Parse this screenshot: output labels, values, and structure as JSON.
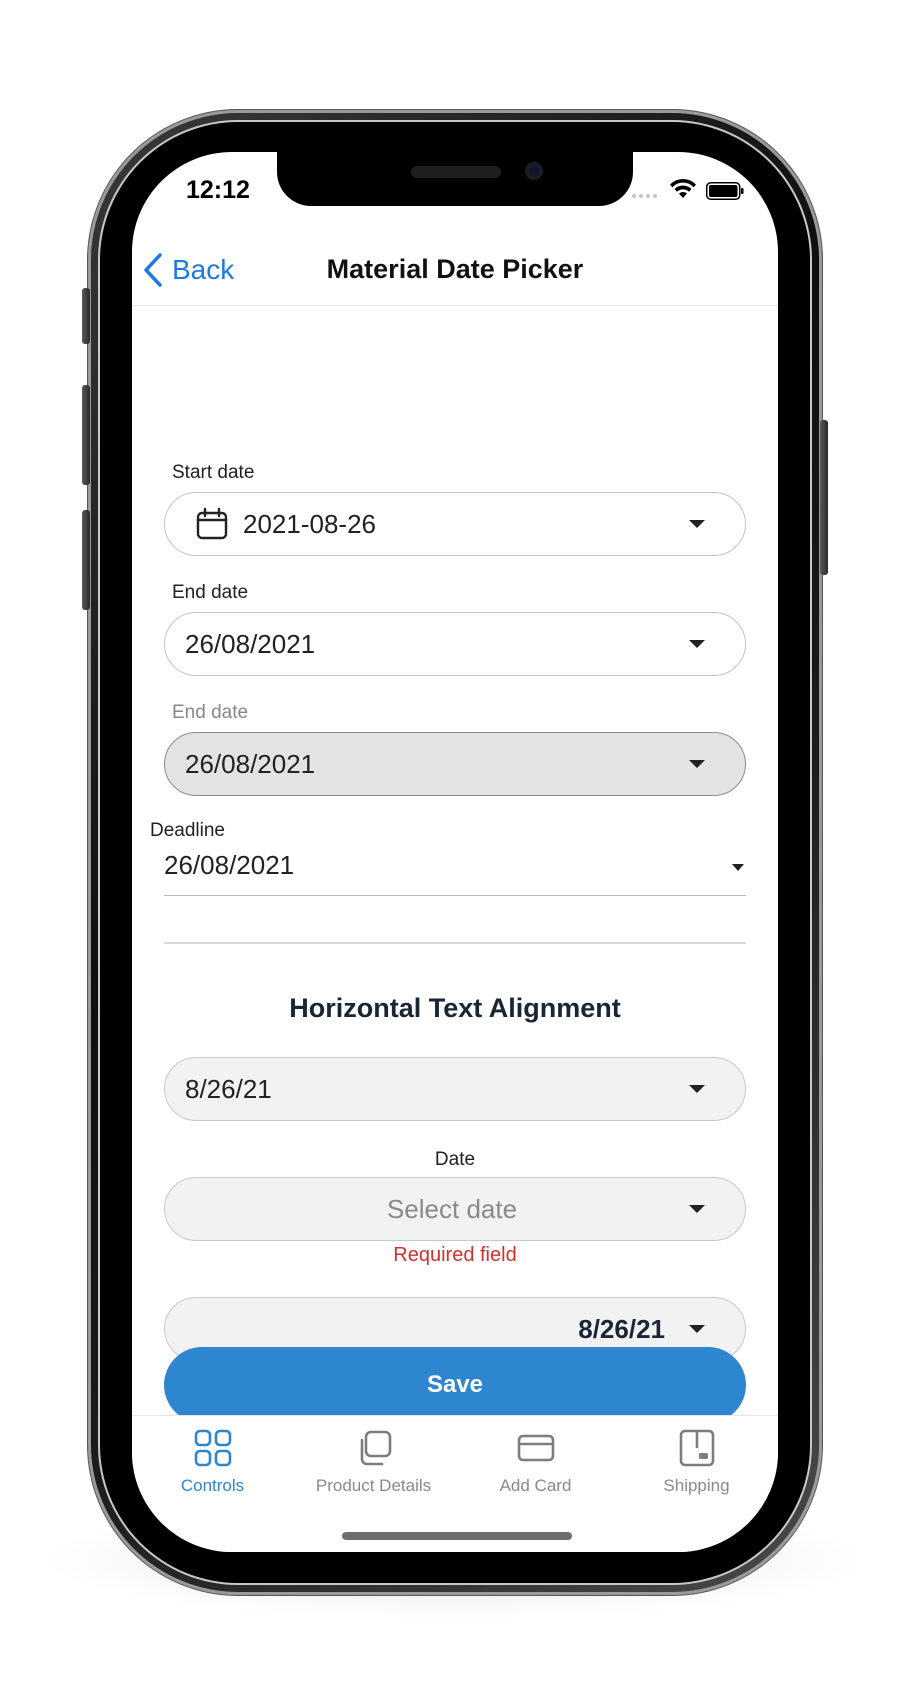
{
  "status_bar": {
    "time": "12:12"
  },
  "navbar": {
    "back_label": "Back",
    "title": "Material Date Picker"
  },
  "fields": {
    "start_date": {
      "label": "Start date",
      "value": "2021-08-26",
      "icon": "calendar-icon"
    },
    "end_date": {
      "label": "End date",
      "value": "26/08/2021"
    },
    "end_date_disabled": {
      "label": "End date",
      "value": "26/08/2021"
    },
    "deadline": {
      "label": "Deadline",
      "value": "26/08/2021"
    }
  },
  "section": {
    "heading": "Horizontal Text Alignment"
  },
  "alignment_fields": {
    "left_aligned": {
      "value": "8/26/21"
    },
    "center_aligned": {
      "label": "Date",
      "placeholder": "Select date",
      "error": "Required field"
    },
    "right_aligned": {
      "value": "8/26/21"
    }
  },
  "save_button": {
    "label": "Save"
  },
  "tabbar": {
    "items": [
      {
        "label": "Controls",
        "icon": "grid-icon",
        "active": true
      },
      {
        "label": "Product Details",
        "icon": "copy-icon",
        "active": false
      },
      {
        "label": "Add Card",
        "icon": "credit-card-icon",
        "active": false
      },
      {
        "label": "Shipping",
        "icon": "package-icon",
        "active": false
      }
    ]
  },
  "colors": {
    "accent": "#2f86d0",
    "ios_link": "#1f7ae0",
    "error": "#d32f2f",
    "heading": "#1a2536"
  }
}
